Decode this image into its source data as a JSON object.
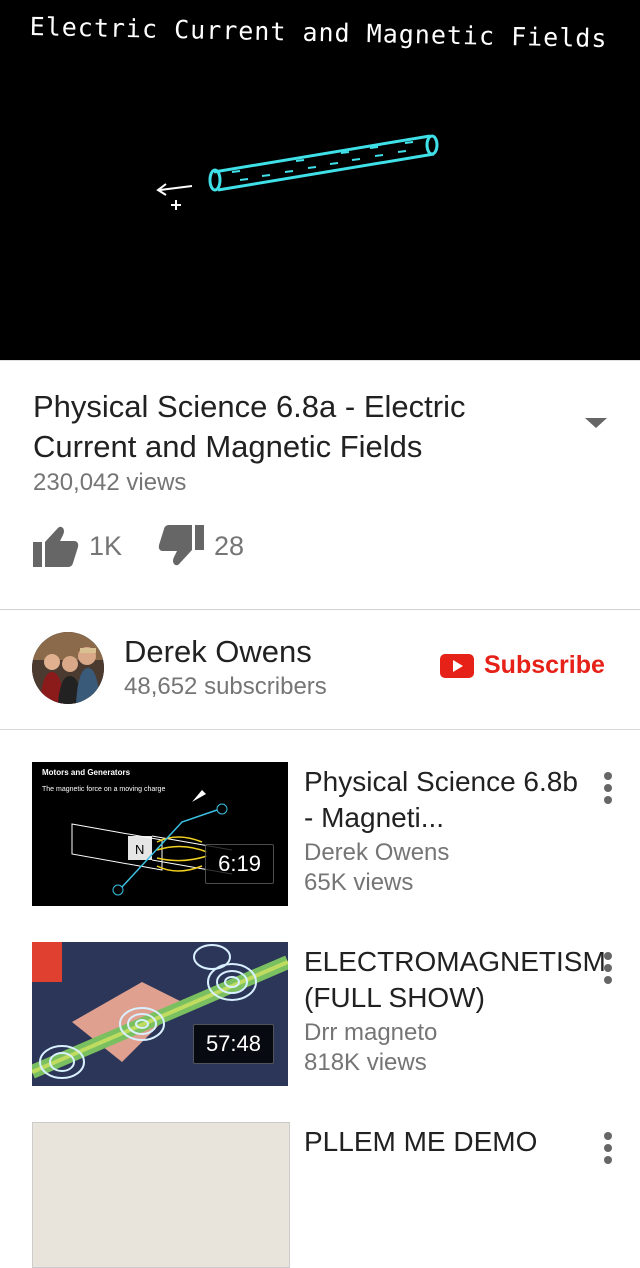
{
  "player": {
    "title": "Electric Current and Magnetic Fields"
  },
  "video": {
    "title": "Physical Science 6.8a - Electric Current and Magnetic Fields",
    "views": "230,042 views",
    "likes": "1K",
    "dislikes": "28"
  },
  "channel": {
    "name": "Derek Owens",
    "subscribers": "48,652 subscribers",
    "subscribe_label": "Subscribe"
  },
  "recommendations": [
    {
      "title": "Physical Science 6.8b - Magneti...",
      "channel": "Derek Owens",
      "views": "65K views",
      "duration": "6:19",
      "thumb_heading": "Motors and Generators",
      "thumb_subheading": "The magnetic force on a moving charge"
    },
    {
      "title": "ELECTROMAGNETISM (FULL SHOW)",
      "channel": "Drr magneto",
      "views": "818K views",
      "duration": "57:48"
    },
    {
      "title": "PLLEM ME DEMO"
    }
  ],
  "colors": {
    "subscribe": "#e62117",
    "secondary_text": "#757575",
    "wire": "#3fe0e8"
  },
  "icons": [
    "expand-icon",
    "thumbs-up-icon",
    "thumbs-down-icon",
    "youtube-play-icon",
    "more-vert-icon"
  ]
}
